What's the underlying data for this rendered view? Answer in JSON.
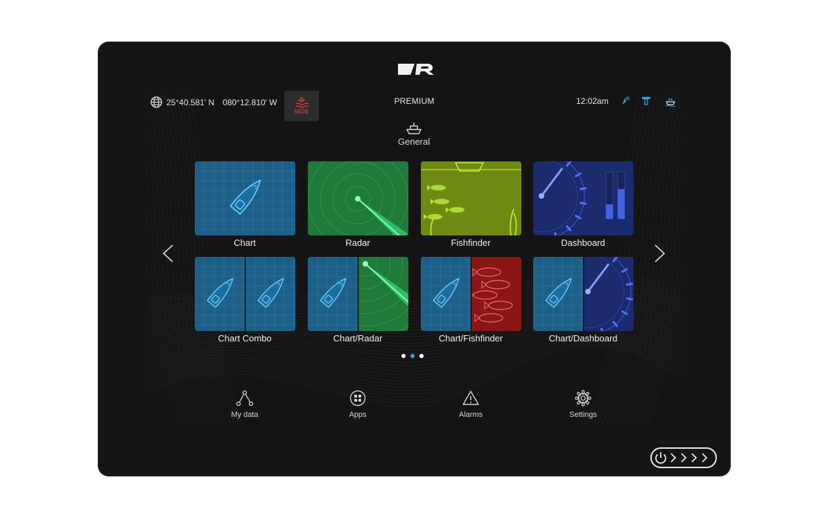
{
  "status_bar": {
    "latitude": "25°40.581' N",
    "longitude": "080°12.810' W",
    "mob_label": "MOB",
    "mode": "PREMIUM",
    "time": "12:02am",
    "icons": [
      "globe-icon",
      "gps-icon",
      "transducer-icon",
      "boat-status-icon"
    ]
  },
  "category": {
    "label": "General",
    "icon": "boat-icon"
  },
  "apps": [
    {
      "label": "Chart",
      "kind": "chart"
    },
    {
      "label": "Radar",
      "kind": "radar"
    },
    {
      "label": "Fishfinder",
      "kind": "fishfinder"
    },
    {
      "label": "Dashboard",
      "kind": "dashboard"
    },
    {
      "label": "Chart Combo",
      "kind": "chart-chart"
    },
    {
      "label": "Chart/Radar",
      "kind": "chart-radar"
    },
    {
      "label": "Chart/Fishfinder",
      "kind": "chart-fishfinder"
    },
    {
      "label": "Chart/Dashboard",
      "kind": "chart-dashboard"
    }
  ],
  "pagination": {
    "pages": 3,
    "current": 2
  },
  "bottom_nav": [
    {
      "label": "My data",
      "icon": "network-icon"
    },
    {
      "label": "Apps",
      "icon": "apps-icon"
    },
    {
      "label": "Alarms",
      "icon": "warning-icon"
    },
    {
      "label": "Settings",
      "icon": "gear-icon"
    }
  ],
  "colors": {
    "accent": "#2aa7e8",
    "mob": "#e0433b",
    "chart": "#1e5f87",
    "radar": "#1f7a3c",
    "fishfinder": "#6e8a12",
    "dashboard": "#1c2a6e",
    "sonar_red": "#8a1616"
  }
}
